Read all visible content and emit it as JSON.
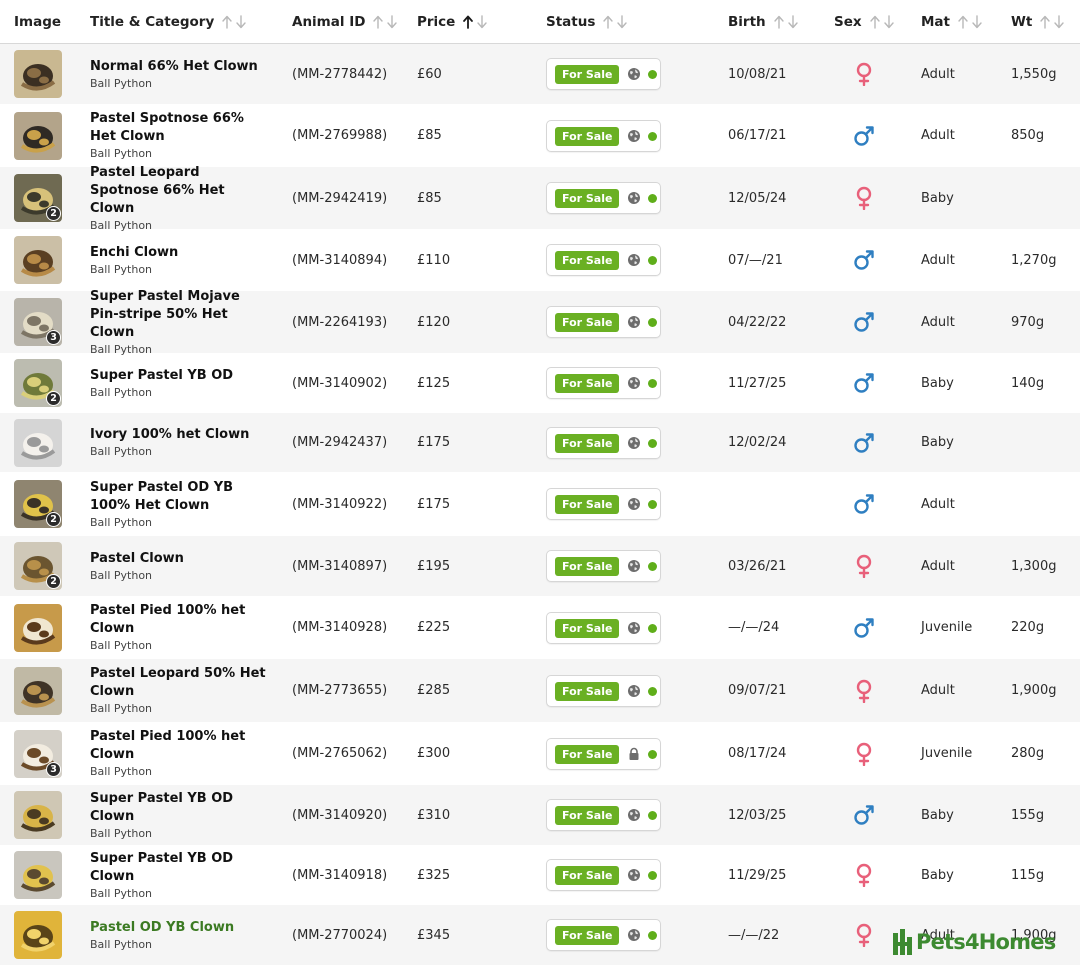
{
  "header": {
    "image": "Image",
    "title_category": "Title & Category",
    "animal_id": "Animal ID",
    "price": "Price",
    "status": "Status",
    "birth": "Birth",
    "sex": "Sex",
    "mat": "Mat",
    "wt": "Wt"
  },
  "colors": {
    "status_pill": "#6ab023",
    "online_dot": "#5fae1a",
    "female": "#e8607a",
    "male": "#2f7fc1",
    "brand": "#3d8a31"
  },
  "rows": [
    {
      "title": "Normal 66% Het Clown",
      "category": "Ball Python",
      "id": "(MM-2778442)",
      "price": "£60",
      "status": "For Sale",
      "visibility": "globe-icon",
      "birth": "10/08/21",
      "sex": "female",
      "maturity": "Adult",
      "weight": "1,550g",
      "photos": ""
    },
    {
      "title": "Pastel Spotnose 66% Het Clown",
      "category": "Ball Python",
      "id": "(MM-2769988)",
      "price": "£85",
      "status": "For Sale",
      "visibility": "globe-icon",
      "birth": "06/17/21",
      "sex": "male",
      "maturity": "Adult",
      "weight": "850g",
      "photos": ""
    },
    {
      "title": "Pastel Leopard Spotnose 66% Het Clown",
      "category": "Ball Python",
      "id": "(MM-2942419)",
      "price": "£85",
      "status": "For Sale",
      "visibility": "globe-icon",
      "birth": "12/05/24",
      "sex": "female",
      "maturity": "Baby",
      "weight": "",
      "photos": "2"
    },
    {
      "title": "Enchi Clown",
      "category": "Ball Python",
      "id": "(MM-3140894)",
      "price": "£110",
      "status": "For Sale",
      "visibility": "globe-icon",
      "birth": "07/—/21",
      "sex": "male",
      "maturity": "Adult",
      "weight": "1,270g",
      "photos": ""
    },
    {
      "title": "Super Pastel Mojave Pin-stripe 50% Het Clown",
      "category": "Ball Python",
      "id": "(MM-2264193)",
      "price": "£120",
      "status": "For Sale",
      "visibility": "globe-icon",
      "birth": "04/22/22",
      "sex": "male",
      "maturity": "Adult",
      "weight": "970g",
      "photos": "3"
    },
    {
      "title": "Super Pastel YB OD",
      "category": "Ball Python",
      "id": "(MM-3140902)",
      "price": "£125",
      "status": "For Sale",
      "visibility": "globe-icon",
      "birth": "11/27/25",
      "sex": "male",
      "maturity": "Baby",
      "weight": "140g",
      "photos": "2"
    },
    {
      "title": "Ivory 100% het Clown",
      "category": "Ball Python",
      "id": "(MM-2942437)",
      "price": "£175",
      "status": "For Sale",
      "visibility": "globe-icon",
      "birth": "12/02/24",
      "sex": "male",
      "maturity": "Baby",
      "weight": "",
      "photos": ""
    },
    {
      "title": "Super Pastel OD YB 100% Het Clown",
      "category": "Ball Python",
      "id": "(MM-3140922)",
      "price": "£175",
      "status": "For Sale",
      "visibility": "globe-icon",
      "birth": "",
      "sex": "male",
      "maturity": "Adult",
      "weight": "",
      "photos": "2"
    },
    {
      "title": "Pastel Clown",
      "category": "Ball Python",
      "id": "(MM-3140897)",
      "price": "£195",
      "status": "For Sale",
      "visibility": "globe-icon",
      "birth": "03/26/21",
      "sex": "female",
      "maturity": "Adult",
      "weight": "1,300g",
      "photos": "2"
    },
    {
      "title": "Pastel Pied 100% het Clown",
      "category": "Ball Python",
      "id": "(MM-3140928)",
      "price": "£225",
      "status": "For Sale",
      "visibility": "globe-icon",
      "birth": "—/—/24",
      "sex": "male",
      "maturity": "Juvenile",
      "weight": "220g",
      "photos": ""
    },
    {
      "title": "Pastel Leopard 50% Het Clown",
      "category": "Ball Python",
      "id": "(MM-2773655)",
      "price": "£285",
      "status": "For Sale",
      "visibility": "globe-icon",
      "birth": "09/07/21",
      "sex": "female",
      "maturity": "Adult",
      "weight": "1,900g",
      "photos": ""
    },
    {
      "title": "Pastel Pied 100% het Clown",
      "category": "Ball Python",
      "id": "(MM-2765062)",
      "price": "£300",
      "status": "For Sale",
      "visibility": "lock-icon",
      "birth": "08/17/24",
      "sex": "female",
      "maturity": "Juvenile",
      "weight": "280g",
      "photos": "3"
    },
    {
      "title": "Super Pastel YB OD Clown",
      "category": "Ball Python",
      "id": "(MM-3140920)",
      "price": "£310",
      "status": "For Sale",
      "visibility": "globe-icon",
      "birth": "12/03/25",
      "sex": "male",
      "maturity": "Baby",
      "weight": "155g",
      "photos": ""
    },
    {
      "title": "Super Pastel YB OD Clown",
      "category": "Ball Python",
      "id": "(MM-3140918)",
      "price": "£325",
      "status": "For Sale",
      "visibility": "globe-icon",
      "birth": "11/29/25",
      "sex": "female",
      "maturity": "Baby",
      "weight": "115g",
      "photos": ""
    },
    {
      "title": "Pastel OD YB Clown",
      "category": "Ball Python",
      "id": "(MM-2770024)",
      "price": "£345",
      "status": "For Sale",
      "visibility": "globe-icon",
      "birth": "—/—/22",
      "sex": "female",
      "maturity": "Adult",
      "weight": "1,900g",
      "photos": "",
      "highlight": true
    }
  ],
  "brand": {
    "logo_text": "Pets4Homes",
    "icon": "pets4homes-logo-icon"
  }
}
